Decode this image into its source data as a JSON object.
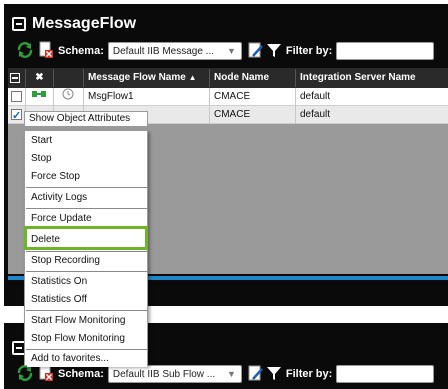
{
  "panel1": {
    "title": "MessageFlow",
    "schema_label": "Schema:",
    "schema_value": "Default IIB Message ...",
    "filter_label": "Filter by:",
    "filter_value": ""
  },
  "grid": {
    "columns": [
      "Message Flow Name",
      "Node Name",
      "Integration Server Name"
    ],
    "rows": [
      {
        "name": "MsgFlow1",
        "node": "CMACE",
        "server": "default",
        "checked": false
      },
      {
        "name": "",
        "node": "CMACE",
        "server": "default",
        "checked": true
      }
    ]
  },
  "context_menu": {
    "items": [
      "Show Object Attributes",
      "Start",
      "Stop",
      "Force Stop",
      "Activity Logs",
      "Force Update",
      "Delete",
      "Stop Recording",
      "Statistics On",
      "Statistics Off",
      "Start Flow Monitoring",
      "Stop Flow Monitoring",
      "Add to favorites..."
    ],
    "highlighted": "Delete",
    "highlight_color": "#6fb32a"
  },
  "panel2": {
    "schema_label": "Schema:",
    "schema_value": "Default IIB Sub Flow ...",
    "filter_label": "Filter by:",
    "filter_value": ""
  },
  "colors": {
    "panel_bg": "#0a0a0a",
    "accent_blue": "#1c86c8",
    "refresh_green": "#2e9e3a"
  }
}
